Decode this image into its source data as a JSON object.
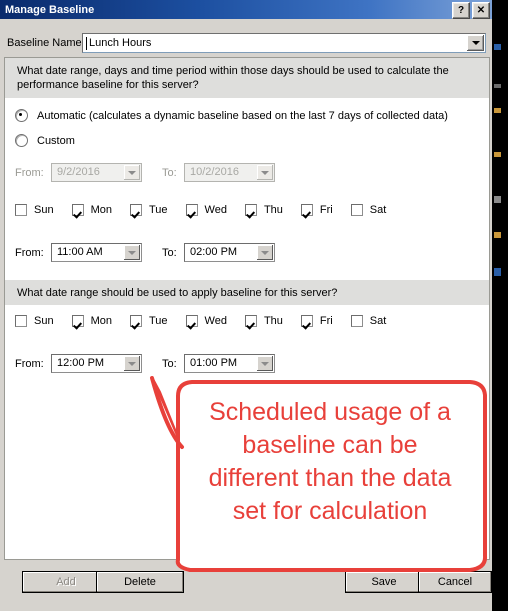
{
  "window": {
    "title": "Manage Baseline",
    "help_button": "?",
    "close_button": "✕"
  },
  "baseline_name": {
    "label": "Baseline Name",
    "value": "Lunch Hours",
    "placeholder": "Baseline Name"
  },
  "calculate_section": {
    "question": "What date range, days and time period within those days should be used to calculate the performance baseline for this server?",
    "options": [
      {
        "label": "Automatic (calculates a dynamic baseline based on the last 7 days of collected data)",
        "selected": true
      },
      {
        "label": "Custom",
        "selected": false
      }
    ],
    "date_range": {
      "from_label": "From:",
      "from_value": "9/2/2016",
      "to_label": "To:",
      "to_value": "10/2/2016",
      "disabled": true
    },
    "days": [
      {
        "label": "Sun",
        "checked": false
      },
      {
        "label": "Mon",
        "checked": true
      },
      {
        "label": "Tue",
        "checked": true
      },
      {
        "label": "Wed",
        "checked": true
      },
      {
        "label": "Thu",
        "checked": true
      },
      {
        "label": "Fri",
        "checked": true
      },
      {
        "label": "Sat",
        "checked": false
      }
    ],
    "time_range": {
      "from_label": "From:",
      "from_value": "11:00 AM",
      "to_label": "To:",
      "to_value": "02:00 PM",
      "disabled": false
    }
  },
  "apply_section": {
    "question": "What date range should be used to apply baseline for this server?",
    "days": [
      {
        "label": "Sun",
        "checked": false
      },
      {
        "label": "Mon",
        "checked": true
      },
      {
        "label": "Tue",
        "checked": true
      },
      {
        "label": "Wed",
        "checked": true
      },
      {
        "label": "Thu",
        "checked": true
      },
      {
        "label": "Fri",
        "checked": true
      },
      {
        "label": "Sat",
        "checked": false
      }
    ],
    "time_range": {
      "from_label": "From:",
      "from_value": "12:00 PM",
      "to_label": "To:",
      "to_value": "01:00 PM",
      "disabled": false
    }
  },
  "buttons": {
    "add": "Add",
    "add_disabled": true,
    "delete": "Delete",
    "save": "Save",
    "cancel": "Cancel"
  },
  "annotation": {
    "text": "Scheduled usage of a baseline can be different than the data set for calculation",
    "color": "#e8403a"
  }
}
